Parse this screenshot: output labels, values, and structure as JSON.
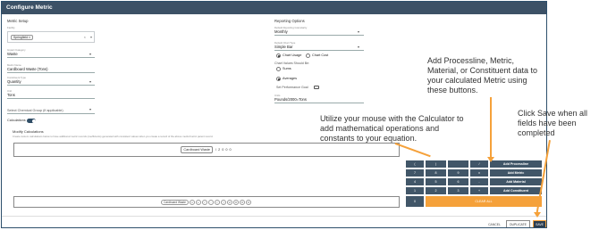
{
  "title": "Configure Metric",
  "left": {
    "metric_setup": "Metric Setup",
    "facility_label": "Facility",
    "facility_tag": "Springfield",
    "impact_label": "Impact Category",
    "impact_value": "Waste",
    "metric_name_label": "Metric Name",
    "metric_name_value": "Cardboard Waste (Tons)",
    "constituent_label": "Constituent Type",
    "constituent_value": "Quantity",
    "unit_label": "Unit",
    "unit_value": "Tons",
    "chemical_group": "Select Chemical Group (if applicable)",
    "calculations_label": "Calculations"
  },
  "right": {
    "reporting_options": "Reporting Options",
    "freq_label": "Default Reporting Granularity",
    "freq_value": "Monthly",
    "chart_type_label": "Default Chart Type",
    "chart_type_value": "Simple Bar",
    "chart_usage": "Chart Usage",
    "chart_cost": "Chart Cost",
    "chart_values_label": "Chart Values Should Be:",
    "sums": "Sums",
    "averages": "Averages",
    "set_perf_goal": "Set Performance Goal",
    "units_label": "Units",
    "units_value": "Pounds/2000=Tons"
  },
  "modify": {
    "title": "Modify Calculations",
    "desc": "Create custom calculations below to have additional metric records (coefficients) generated with consistent values when you create a record of the above metric/metric parent record.",
    "formula_chip": "Cardboard Waste",
    "formula_tokens": [
      "/",
      "2",
      "0",
      "0",
      "0"
    ]
  },
  "palette": {
    "chip": "Cardboard Waste",
    "circles": [
      "x",
      "+",
      "/",
      "-",
      "(",
      ")",
      "2",
      "0",
      "0",
      "0"
    ]
  },
  "keypad": {
    "row1": [
      "(",
      ")",
      "",
      "/"
    ],
    "row2": [
      "7",
      "8",
      "9",
      "x"
    ],
    "row3": [
      "4",
      "5",
      "6",
      "-"
    ],
    "row4": [
      "1",
      "2",
      "3",
      "+"
    ],
    "zero": "0",
    "clear": "CLEAR ALL",
    "add_processline": "Add Processline",
    "add_metric": "Add Metric",
    "add_material": "Add Material",
    "add_constituent": "Add Constituent"
  },
  "footer": {
    "cancel": "CANCEL",
    "duplicate": "DUPLICATE",
    "save": "SAVE"
  },
  "annotations": {
    "add_buttons": "Add Processline, Metric, Material, or Constituent data to your calculated Metric using these buttons.",
    "calculator": "Utilize your mouse with the Calculator to add mathematical operations and constants to your equation.",
    "save": "Click Save when all fields have been completed"
  },
  "colors": {
    "header": "#3c5166",
    "keypad": "#415668",
    "accent": "#f5a13a"
  }
}
